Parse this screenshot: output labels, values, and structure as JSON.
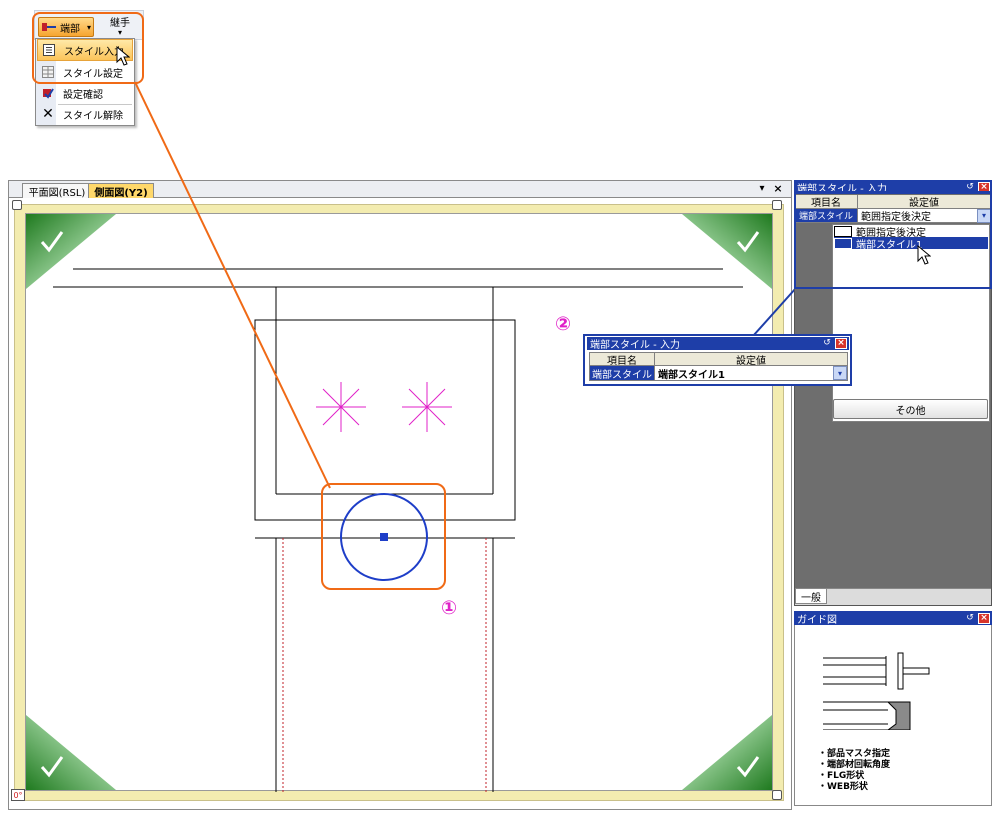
{
  "toolbar": {
    "endpoint_button": "端部",
    "joint_button": "継手"
  },
  "menu": {
    "items": [
      {
        "label": "スタイル入力",
        "icon": "style-input-icon",
        "highlighted": true
      },
      {
        "label": "スタイル設定",
        "icon": "style-settings-icon",
        "highlighted": false
      },
      {
        "label": "設定確認",
        "icon": "settings-check-icon",
        "highlighted": false
      },
      {
        "label": "スタイル解除",
        "icon": "style-clear-icon",
        "highlighted": false
      }
    ]
  },
  "document": {
    "tabs": [
      {
        "label": "平面図(RSL)",
        "active": false
      },
      {
        "label": "側面図(Y2)",
        "active": true
      }
    ],
    "window_buttons": [
      "▾",
      "×"
    ],
    "corner_label": "0°"
  },
  "callouts": {
    "one": "①",
    "two": "②"
  },
  "style_panel": {
    "title": "端部スタイル - 入力",
    "col_name": "項目名",
    "col_value": "設定値",
    "row_name": "端部スタイル",
    "row_value": "範囲指定後決定",
    "options": [
      "範囲指定後決定",
      "端部スタイル1"
    ],
    "other_button": "その他",
    "bottom_tab": "一般"
  },
  "zoom_panel": {
    "title": "端部スタイル - 入力",
    "col_name": "項目名",
    "col_value": "設定値",
    "row_name": "端部スタイル",
    "row_value": "端部スタイル1"
  },
  "guide_panel": {
    "title": "ガイド図",
    "notes": [
      "・部品マスタ指定",
      "・端部材回転角度",
      "・FLG形状",
      "・WEB形状"
    ]
  },
  "colors": {
    "accent_orange": "#f06a16",
    "highlight_blue": "#1e3ea8",
    "magenta": "#e020c8",
    "circle_blue": "#1e3ec8",
    "viewport_border": "#f3ecb0",
    "green_corner": "#2a8a2a"
  }
}
